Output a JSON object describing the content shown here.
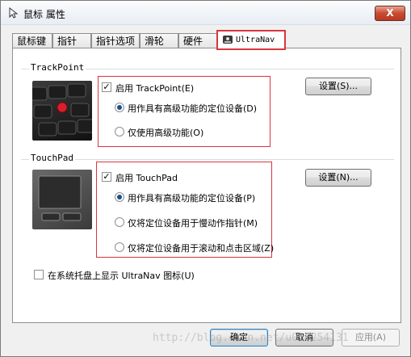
{
  "window": {
    "title": "鼠标 属性",
    "close_label": "X"
  },
  "tabs": [
    {
      "label": "鼠标键"
    },
    {
      "label": "指针"
    },
    {
      "label": "指针选项"
    },
    {
      "label": "滑轮"
    },
    {
      "label": "硬件"
    },
    {
      "label": "UltraNav",
      "active": true
    }
  ],
  "trackpoint": {
    "group_title": "TrackPoint",
    "enable_label": "启用 TrackPoint(E)",
    "enable_checked": true,
    "settings_button": "设置(S)...",
    "options": [
      {
        "label": "用作具有高级功能的定位设备(D)",
        "selected": true
      },
      {
        "label": "仅使用高级功能(O)",
        "selected": false
      }
    ]
  },
  "touchpad": {
    "group_title": "TouchPad",
    "enable_label": "启用 TouchPad",
    "enable_checked": true,
    "settings_button": "设置(N)...",
    "options": [
      {
        "label": "用作具有高级功能的定位设备(P)",
        "selected": true
      },
      {
        "label": "仅将定位设备用于慢动作指针(M)",
        "selected": false
      },
      {
        "label": "仅将定位设备用于滚动和点击区域(Z)",
        "selected": false
      }
    ]
  },
  "tray_icon": {
    "label": "在系统托盘上显示 UltraNav 图标(U)",
    "checked": false
  },
  "footer": {
    "ok": "确定",
    "cancel": "取消",
    "apply": "应用(A)"
  },
  "watermark": "http://blog.csdn.net/u010254131",
  "colors": {
    "highlight_box": "#d9363e",
    "trackpoint_nub": "#d91f2a"
  }
}
